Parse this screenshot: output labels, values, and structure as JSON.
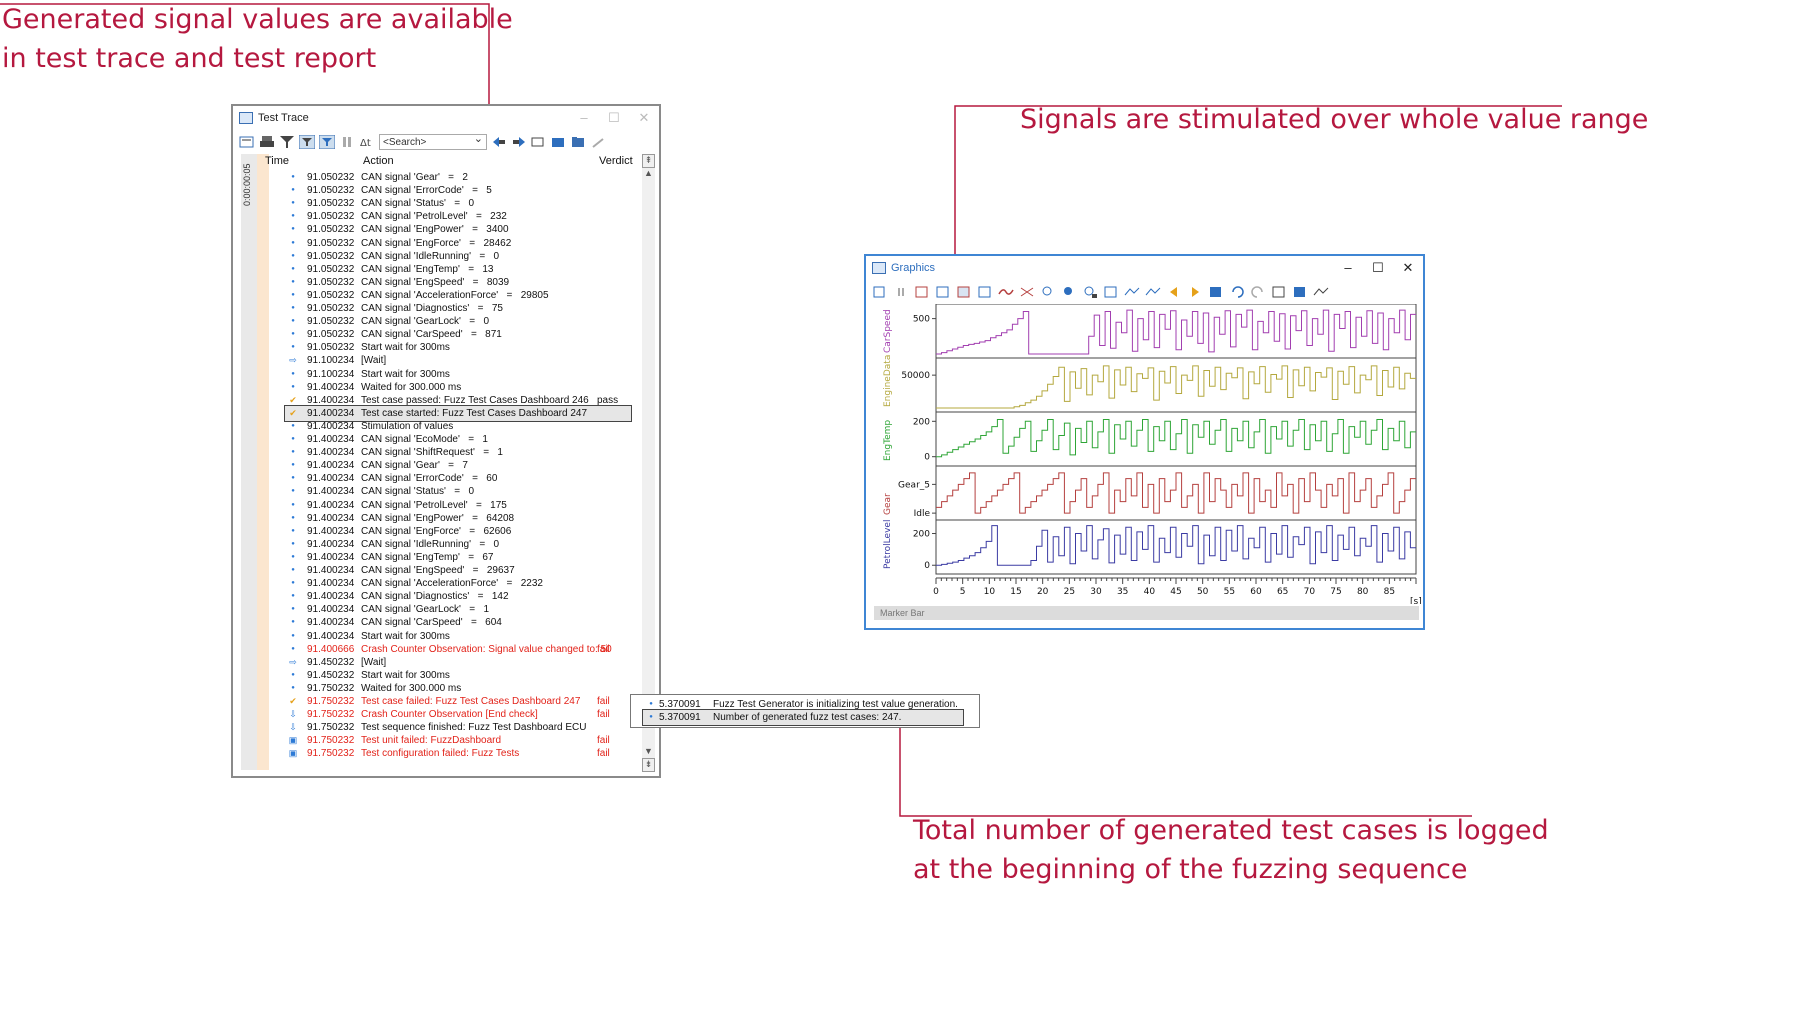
{
  "callouts": {
    "top_left": [
      "Generated signal values are available",
      "in test trace and test report"
    ],
    "top_right": "Signals are stimulated over whole value range",
    "bottom": [
      "Total number of generated test cases is logged",
      "at the beginning of the fuzzing sequence"
    ]
  },
  "colors": {
    "accent": "#b5183f",
    "fail": "#e2231a",
    "carspeed": "#a23fb0",
    "enginedata": "#b4a83e",
    "engtemp": "#2ea536",
    "gear": "#b5403f",
    "petrollevel": "#3b3ba3"
  },
  "trace": {
    "title": "Test Trace",
    "search_placeholder": "<Search>",
    "time_ruler": "0:00:00:05",
    "columns": {
      "time": "Time",
      "action": "Action",
      "verdict": "Verdict"
    },
    "rows": [
      {
        "icon": "dot",
        "time": "91.050232",
        "action": "CAN signal 'Gear'   =   2",
        "verdict": "",
        "status": "normal"
      },
      {
        "icon": "dot",
        "time": "91.050232",
        "action": "CAN signal 'ErrorCode'   =   5",
        "verdict": "",
        "status": "normal"
      },
      {
        "icon": "dot",
        "time": "91.050232",
        "action": "CAN signal 'Status'   =   0",
        "verdict": "",
        "status": "normal"
      },
      {
        "icon": "dot",
        "time": "91.050232",
        "action": "CAN signal 'PetrolLevel'   =   232",
        "verdict": "",
        "status": "normal"
      },
      {
        "icon": "dot",
        "time": "91.050232",
        "action": "CAN signal 'EngPower'   =   3400",
        "verdict": "",
        "status": "normal"
      },
      {
        "icon": "dot",
        "time": "91.050232",
        "action": "CAN signal 'EngForce'   =   28462",
        "verdict": "",
        "status": "normal"
      },
      {
        "icon": "dot",
        "time": "91.050232",
        "action": "CAN signal 'IdleRunning'   =   0",
        "verdict": "",
        "status": "normal"
      },
      {
        "icon": "dot",
        "time": "91.050232",
        "action": "CAN signal 'EngTemp'   =   13",
        "verdict": "",
        "status": "normal"
      },
      {
        "icon": "dot",
        "time": "91.050232",
        "action": "CAN signal 'EngSpeed'   =   8039",
        "verdict": "",
        "status": "normal"
      },
      {
        "icon": "dot",
        "time": "91.050232",
        "action": "CAN signal 'AccelerationForce'   =   29805",
        "verdict": "",
        "status": "normal"
      },
      {
        "icon": "dot",
        "time": "91.050232",
        "action": "CAN signal 'Diagnostics'   =   75",
        "verdict": "",
        "status": "normal"
      },
      {
        "icon": "dot",
        "time": "91.050232",
        "action": "CAN signal 'GearLock'   =   0",
        "verdict": "",
        "status": "normal"
      },
      {
        "icon": "dot",
        "time": "91.050232",
        "action": "CAN signal 'CarSpeed'   =   871",
        "verdict": "",
        "status": "normal"
      },
      {
        "icon": "dot",
        "time": "91.050232",
        "action": "Start wait for 300ms",
        "verdict": "",
        "status": "normal"
      },
      {
        "icon": "arrow",
        "time": "91.100234",
        "action": "[Wait]",
        "verdict": "",
        "status": "normal"
      },
      {
        "icon": "dot",
        "time": "91.100234",
        "action": "Start wait for 300ms",
        "verdict": "",
        "status": "normal"
      },
      {
        "icon": "dot",
        "time": "91.400234",
        "action": "Waited for 300.000 ms",
        "verdict": "",
        "status": "normal"
      },
      {
        "icon": "check",
        "time": "91.400234",
        "action": "Test case passed: Fuzz Test Cases Dashboard 246",
        "verdict": "pass",
        "status": "normal"
      },
      {
        "icon": "check",
        "time": "91.400234",
        "action": "Test case started: Fuzz Test Cases Dashboard 247",
        "verdict": "",
        "status": "selected"
      },
      {
        "icon": "dot",
        "time": "91.400234",
        "action": "Stimulation of values",
        "verdict": "",
        "status": "normal"
      },
      {
        "icon": "dot",
        "time": "91.400234",
        "action": "CAN signal 'EcoMode'   =   1",
        "verdict": "",
        "status": "normal"
      },
      {
        "icon": "dot",
        "time": "91.400234",
        "action": "CAN signal 'ShiftRequest'   =   1",
        "verdict": "",
        "status": "normal"
      },
      {
        "icon": "dot",
        "time": "91.400234",
        "action": "CAN signal 'Gear'   =   7",
        "verdict": "",
        "status": "normal"
      },
      {
        "icon": "dot",
        "time": "91.400234",
        "action": "CAN signal 'ErrorCode'   =   60",
        "verdict": "",
        "status": "normal"
      },
      {
        "icon": "dot",
        "time": "91.400234",
        "action": "CAN signal 'Status'   =   0",
        "verdict": "",
        "status": "normal"
      },
      {
        "icon": "dot",
        "time": "91.400234",
        "action": "CAN signal 'PetrolLevel'   =   175",
        "verdict": "",
        "status": "normal"
      },
      {
        "icon": "dot",
        "time": "91.400234",
        "action": "CAN signal 'EngPower'   =   64208",
        "verdict": "",
        "status": "normal"
      },
      {
        "icon": "dot",
        "time": "91.400234",
        "action": "CAN signal 'EngForce'   =   62606",
        "verdict": "",
        "status": "normal"
      },
      {
        "icon": "dot",
        "time": "91.400234",
        "action": "CAN signal 'IdleRunning'   =   0",
        "verdict": "",
        "status": "normal"
      },
      {
        "icon": "dot",
        "time": "91.400234",
        "action": "CAN signal 'EngTemp'   =   67",
        "verdict": "",
        "status": "normal"
      },
      {
        "icon": "dot",
        "time": "91.400234",
        "action": "CAN signal 'EngSpeed'   =   29637",
        "verdict": "",
        "status": "normal"
      },
      {
        "icon": "dot",
        "time": "91.400234",
        "action": "CAN signal 'AccelerationForce'   =   2232",
        "verdict": "",
        "status": "normal"
      },
      {
        "icon": "dot",
        "time": "91.400234",
        "action": "CAN signal 'Diagnostics'   =   142",
        "verdict": "",
        "status": "normal"
      },
      {
        "icon": "dot",
        "time": "91.400234",
        "action": "CAN signal 'GearLock'   =   1",
        "verdict": "",
        "status": "normal"
      },
      {
        "icon": "dot",
        "time": "91.400234",
        "action": "CAN signal 'CarSpeed'   =   604",
        "verdict": "",
        "status": "normal"
      },
      {
        "icon": "dot",
        "time": "91.400234",
        "action": "Start wait for 300ms",
        "verdict": "",
        "status": "normal"
      },
      {
        "icon": "dot",
        "time": "91.400666",
        "action": "Crash Counter Observation: Signal value changed to: 50",
        "verdict": "fail",
        "status": "fail"
      },
      {
        "icon": "arrow",
        "time": "91.450232",
        "action": "[Wait]",
        "verdict": "",
        "status": "normal"
      },
      {
        "icon": "dot",
        "time": "91.450232",
        "action": "Start wait for 300ms",
        "verdict": "",
        "status": "normal"
      },
      {
        "icon": "dot",
        "time": "91.750232",
        "action": "Waited for 300.000 ms",
        "verdict": "",
        "status": "normal"
      },
      {
        "icon": "check",
        "time": "91.750232",
        "action": "Test case failed: Fuzz Test Cases Dashboard 247",
        "verdict": "fail",
        "status": "fail"
      },
      {
        "icon": "down",
        "time": "91.750232",
        "action": "Crash Counter Observation [End check]",
        "verdict": "fail",
        "status": "fail"
      },
      {
        "icon": "down",
        "time": "91.750232",
        "action": "Test sequence finished: Fuzz Test Dashboard ECU",
        "verdict": "",
        "status": "normal"
      },
      {
        "icon": "unit",
        "time": "91.750232",
        "action": "Test unit failed: FuzzDashboard",
        "verdict": "fail",
        "status": "fail"
      },
      {
        "icon": "unit",
        "time": "91.750232",
        "action": "Test configuration failed: Fuzz Tests",
        "verdict": "fail",
        "status": "fail"
      }
    ]
  },
  "snippet": {
    "rows": [
      {
        "time": "5.370091",
        "action": "Fuzz Test Generator is initializing test value generation."
      },
      {
        "time": "5.370091",
        "action": "Number of generated fuzz test cases: 247."
      }
    ]
  },
  "graphics": {
    "title": "Graphics",
    "marker_bar": "Marker Bar",
    "x_unit": "[s]"
  },
  "chart_data": {
    "type": "line",
    "xlabel": "",
    "x_unit": "[s]",
    "xlim": [
      0,
      90
    ],
    "x_ticks": [
      0,
      5,
      10,
      15,
      20,
      25,
      30,
      35,
      40,
      45,
      50,
      55,
      60,
      65,
      70,
      75,
      80,
      85
    ],
    "series": [
      {
        "name": "CarSpeed",
        "color": "#a23fb0",
        "ytick_labels": [
          "500"
        ],
        "ytick_values": [
          500
        ],
        "ylim": [
          0,
          650
        ],
        "values": [
          0,
          20,
          45,
          70,
          95,
          120,
          135,
          150,
          170,
          190,
          230,
          260,
          300,
          340,
          420,
          500,
          600,
          0,
          0,
          0,
          0,
          0,
          0,
          0,
          0,
          0,
          0,
          0,
          250,
          550,
          120,
          600,
          80,
          450,
          300,
          620,
          40,
          500,
          200,
          600,
          90,
          560,
          350,
          610,
          60,
          480,
          250,
          600,
          150,
          580,
          30,
          520,
          280,
          610,
          100,
          560,
          380,
          620,
          60,
          460,
          300,
          600,
          180,
          570,
          70,
          540,
          330,
          610,
          120,
          500,
          280,
          620,
          40,
          560,
          360,
          600,
          90,
          520,
          250,
          610,
          150,
          580,
          60,
          500,
          300,
          620,
          200,
          560
        ]
      },
      {
        "name": "EngineData",
        "color": "#b4a83e",
        "ytick_labels": [
          "50000"
        ],
        "ytick_values": [
          50000
        ],
        "ylim": [
          0,
          70000
        ],
        "values": [
          0,
          0,
          0,
          0,
          0,
          0,
          0,
          0,
          0,
          0,
          0,
          0,
          0,
          0,
          2000,
          4000,
          8000,
          12000,
          18000,
          26000,
          36000,
          48000,
          62000,
          10000,
          55000,
          30000,
          60000,
          20000,
          50000,
          40000,
          64000,
          15000,
          58000,
          35000,
          62000,
          25000,
          52000,
          45000,
          61000,
          12000,
          56000,
          38000,
          63000,
          22000,
          50000,
          42000,
          64000,
          18000,
          57000,
          33000,
          62000,
          28000,
          53000,
          46000,
          61000,
          14000,
          55000,
          37000,
          63000,
          24000,
          51000,
          44000,
          64000,
          16000,
          58000,
          34000,
          62000,
          26000,
          54000,
          47000,
          61000,
          13000,
          56000,
          36000,
          63000,
          23000,
          50000,
          43000,
          64000,
          19000,
          57000,
          32000,
          62000,
          29000,
          53000,
          45000
        ]
      },
      {
        "name": "EngTemp",
        "color": "#2ea536",
        "ytick_labels": [
          "200",
          "0"
        ],
        "ytick_values": [
          200,
          0
        ],
        "ylim": [
          -30,
          230
        ],
        "values": [
          0,
          10,
          25,
          40,
          55,
          70,
          85,
          100,
          120,
          140,
          170,
          210,
          20,
          60,
          110,
          160,
          200,
          30,
          90,
          150,
          210,
          40,
          120,
          190,
          10,
          160,
          80,
          200,
          50,
          140,
          210,
          20,
          180,
          100,
          200,
          60,
          150,
          210,
          30,
          170,
          90,
          200,
          40,
          130,
          210,
          20,
          180,
          110,
          200,
          70,
          150,
          210,
          30,
          160,
          90,
          200,
          50,
          140,
          210,
          20,
          170,
          100,
          200,
          60,
          150,
          210,
          40,
          180,
          90,
          200,
          30,
          130,
          210,
          20,
          170,
          110,
          200,
          70,
          150,
          210,
          40,
          160,
          90,
          200,
          50,
          140
        ]
      },
      {
        "name": "Gear",
        "color": "#b5403f",
        "ytick_labels": [
          "Gear_5",
          "Idle"
        ],
        "ytick_values": [
          5,
          0
        ],
        "ylim": [
          -0.5,
          7.5
        ],
        "values": [
          1,
          2,
          3,
          4,
          5,
          6,
          7,
          0,
          1,
          2,
          3,
          4,
          5,
          6,
          7,
          0,
          1,
          2,
          3,
          4,
          5,
          6,
          7,
          0,
          2,
          4,
          6,
          1,
          3,
          5,
          7,
          0,
          4,
          2,
          6,
          3,
          7,
          1,
          5,
          0,
          6,
          2,
          4,
          7,
          1,
          3,
          5,
          0,
          7,
          2,
          6,
          4,
          1,
          5,
          3,
          7,
          0,
          6,
          2,
          4,
          1,
          7,
          3,
          5,
          0,
          6,
          2,
          7,
          4,
          1,
          5,
          3,
          6,
          0,
          7,
          2,
          4,
          6,
          1,
          3,
          5,
          7,
          0,
          2,
          4,
          6
        ]
      },
      {
        "name": "PetrolLevel",
        "color": "#3b3ba3",
        "ytick_labels": [
          "200",
          "0"
        ],
        "ytick_values": [
          200,
          0
        ],
        "ylim": [
          -30,
          260
        ],
        "values": [
          0,
          5,
          12,
          20,
          30,
          45,
          60,
          80,
          110,
          150,
          250,
          0,
          0,
          0,
          0,
          0,
          0,
          30,
          120,
          220,
          20,
          180,
          60,
          240,
          10,
          200,
          90,
          250,
          40,
          160,
          230,
          15,
          190,
          70,
          240,
          30,
          210,
          100,
          250,
          20,
          170,
          80,
          240,
          50,
          200,
          120,
          250,
          10,
          190,
          60,
          240,
          30,
          220,
          90,
          250,
          40,
          170,
          110,
          240,
          20,
          200,
          70,
          250,
          50,
          180,
          130,
          240,
          10,
          210,
          80,
          250,
          30,
          190,
          100,
          240,
          60,
          170,
          120,
          250,
          20,
          200,
          90,
          240,
          40,
          210,
          110
        ]
      }
    ]
  }
}
